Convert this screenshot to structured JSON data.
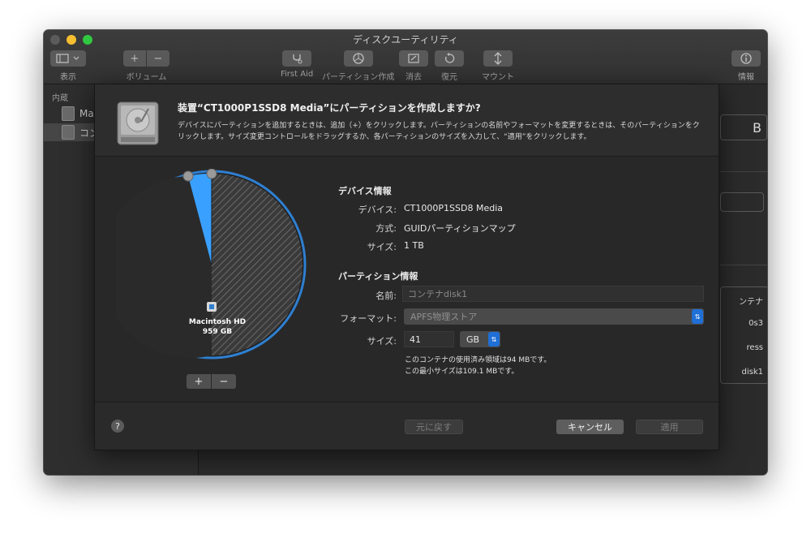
{
  "window": {
    "title": "ディスクユーティリティ"
  },
  "toolbar": {
    "view_label": "表示",
    "volume_label": "ボリューム",
    "volume_add": "+",
    "volume_remove": "−",
    "first_aid_label": "First Aid",
    "partition_label": "パーティション作成",
    "erase_label": "消去",
    "restore_label": "復元",
    "mount_label": "マウント",
    "info_label": "情報"
  },
  "sidebar": {
    "section": "内蔵",
    "items": [
      {
        "label": "Ma"
      },
      {
        "label": "コン"
      }
    ]
  },
  "background_fragments": {
    "capacity_unit": "B",
    "list": [
      "ンテナ",
      "0s3",
      "ress",
      "disk1"
    ]
  },
  "sheet": {
    "title": "装置“CT1000P1SSD8 Media”にパーティションを作成しますか?",
    "description": "デバイスにパーティションを追加するときは、追加（+）をクリックします。パーティションの名前やフォーマットを変更するときは、そのパーティションをクリックします。サイズ変更コントロールをドラッグするか、各パーティションのサイズを入力して、“適用”をクリックします。",
    "pie": {
      "partition_name": "Macintosh HD",
      "partition_size": "959 GB",
      "add_label": "+",
      "remove_label": "−",
      "colors": {
        "main": "#2a2a2a",
        "new": "#3aa0ff",
        "free_hatch": "#6a6a6a",
        "ring": "#2f7fd0"
      }
    },
    "device_info": {
      "heading": "デバイス情報",
      "device_label": "デバイス:",
      "device_value": "CT1000P1SSD8 Media",
      "scheme_label": "方式:",
      "scheme_value": "GUIDパーティションマップ",
      "size_label": "サイズ:",
      "size_value": "1 TB"
    },
    "partition_info": {
      "heading": "パーティション情報",
      "name_label": "名前:",
      "name_placeholder": "コンテナdisk1",
      "format_label": "フォーマット:",
      "format_value": "APFS物理ストア",
      "size_label": "サイズ:",
      "size_value": "41",
      "size_unit": "GB",
      "note_line1": "このコンテナの使用済み領域は94 MBです。",
      "note_line2": "この最小サイズは109.1 MBです。"
    },
    "footer": {
      "help": "?",
      "revert": "元に戻す",
      "cancel": "キャンセル",
      "apply": "適用"
    }
  }
}
